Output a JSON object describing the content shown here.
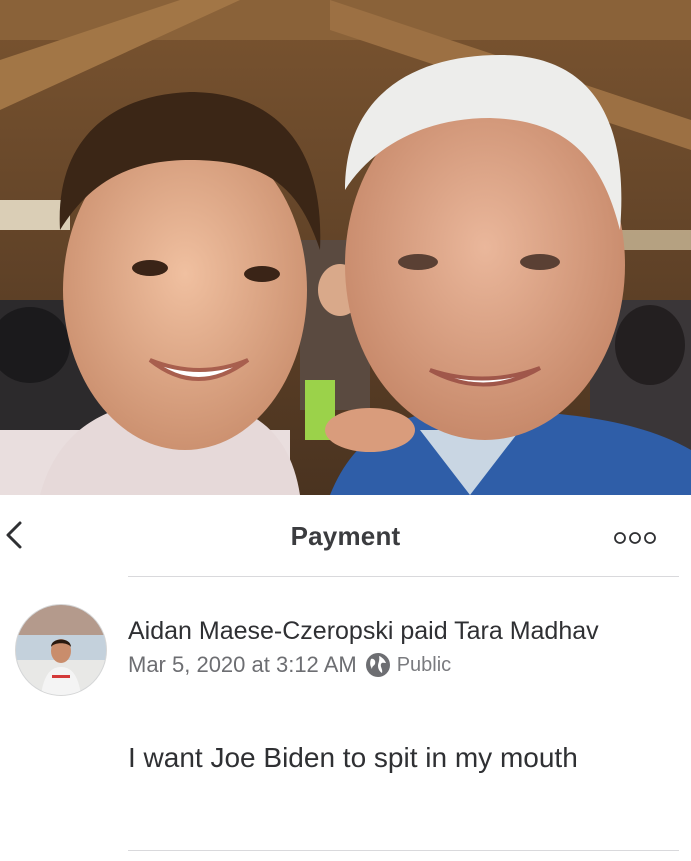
{
  "header": {
    "title": "Payment"
  },
  "story": {
    "actor": "Aidan Maese-Czeropski",
    "verb": "paid",
    "target": "Tara Madhav",
    "date": "Mar 5, 2020 at 3:12 AM",
    "audience": "Public",
    "note": "I want Joe Biden to spit in my mouth"
  },
  "icons": {
    "back": "chevron-left-icon",
    "more": "more-dots-icon",
    "audience": "globe-icon"
  },
  "colors": {
    "text": "#2f3033",
    "muted": "#6d6e72",
    "divider": "#d9d9dc"
  }
}
